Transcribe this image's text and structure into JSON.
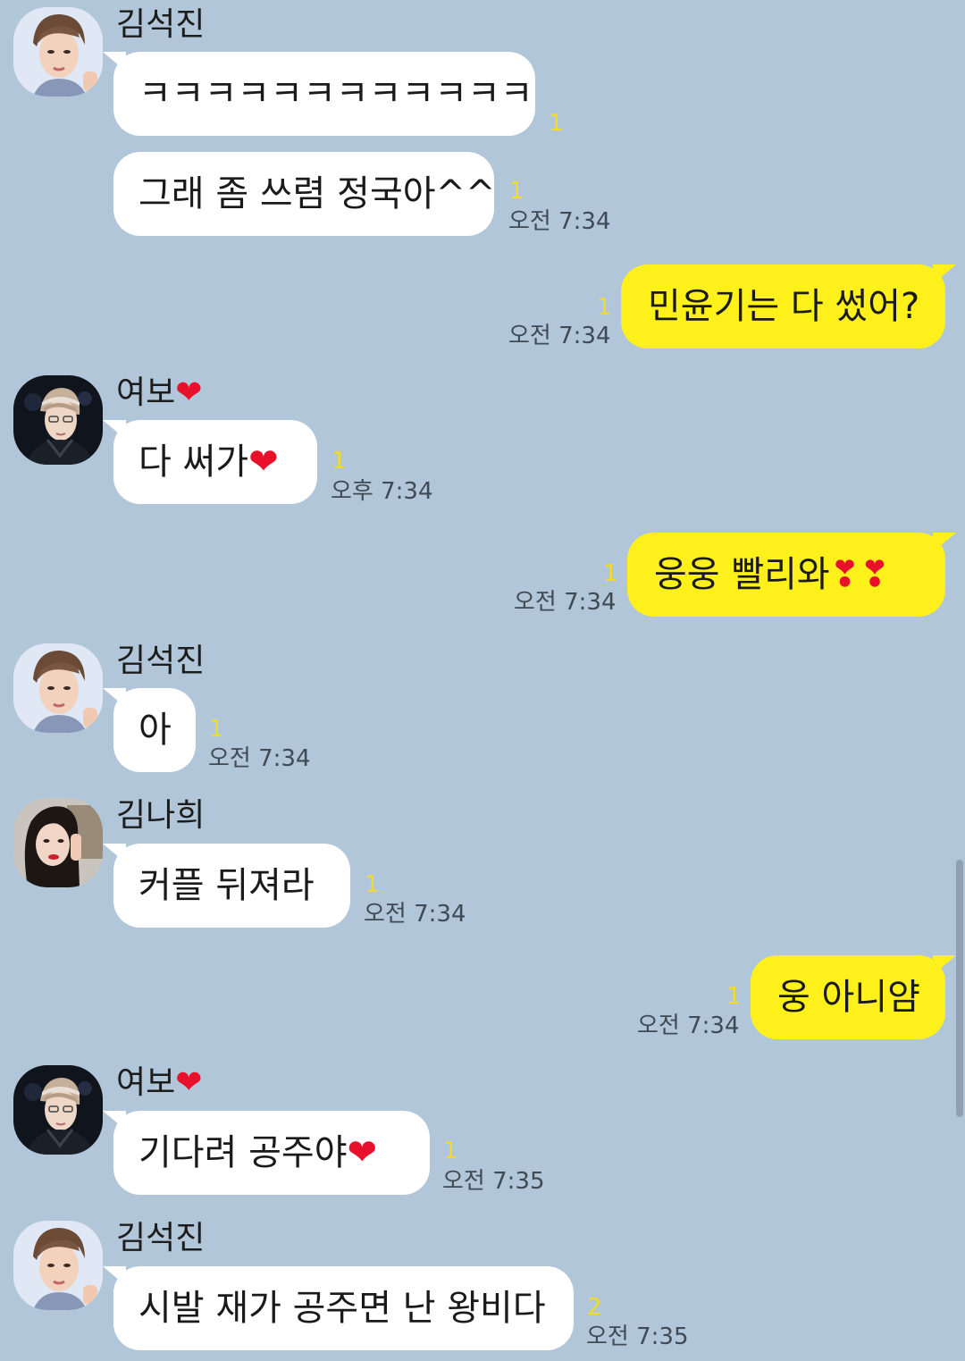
{
  "messages": [
    {
      "sender": "김석진",
      "text": "ㅋㅋㅋㅋㅋㅋㅋㅋㅋㅋㅋㅋ",
      "unread": "1",
      "time": ""
    },
    {
      "text": "그래 좀 쓰렴 정국아^^",
      "unread": "1",
      "time": "오전 7:34"
    },
    {
      "text": "민윤기는 다 썼어?",
      "unread": "1",
      "time": "오전 7:34"
    },
    {
      "sender": "여보",
      "sender_suffix": "❤",
      "text": "다 써가",
      "text_suffix": "❤",
      "unread": "1",
      "time": "오후 7:34"
    },
    {
      "text": "웅웅 빨리와",
      "text_suffix": "❣❣",
      "unread": "1",
      "time": "오전 7:34"
    },
    {
      "sender": "김석진",
      "text": "아",
      "unread": "1",
      "time": "오전 7:34"
    },
    {
      "sender": "김나희",
      "text": "커플 뒤져라",
      "unread": "1",
      "time": "오전 7:34"
    },
    {
      "text": "웅 아니얌",
      "unread": "1",
      "time": "오전 7:34"
    },
    {
      "sender": "여보",
      "sender_suffix": "❤",
      "text": "기다려 공주야",
      "text_suffix": "❤",
      "unread": "1",
      "time": "오전 7:35"
    },
    {
      "sender": "김석진",
      "text": "시발 재가 공주면 난 왕비다",
      "unread": "2",
      "time": "오전 7:35"
    }
  ],
  "colors": {
    "background": "#b2c6d9",
    "incoming_bubble": "#ffffff",
    "outgoing_bubble": "#fef01b",
    "unread_count": "#f2dc26",
    "heart": "#e8102a"
  },
  "icons": {
    "avatar_jin": "avatar-photo",
    "avatar_yeobo": "avatar-photo",
    "avatar_nahee": "avatar-photo"
  }
}
